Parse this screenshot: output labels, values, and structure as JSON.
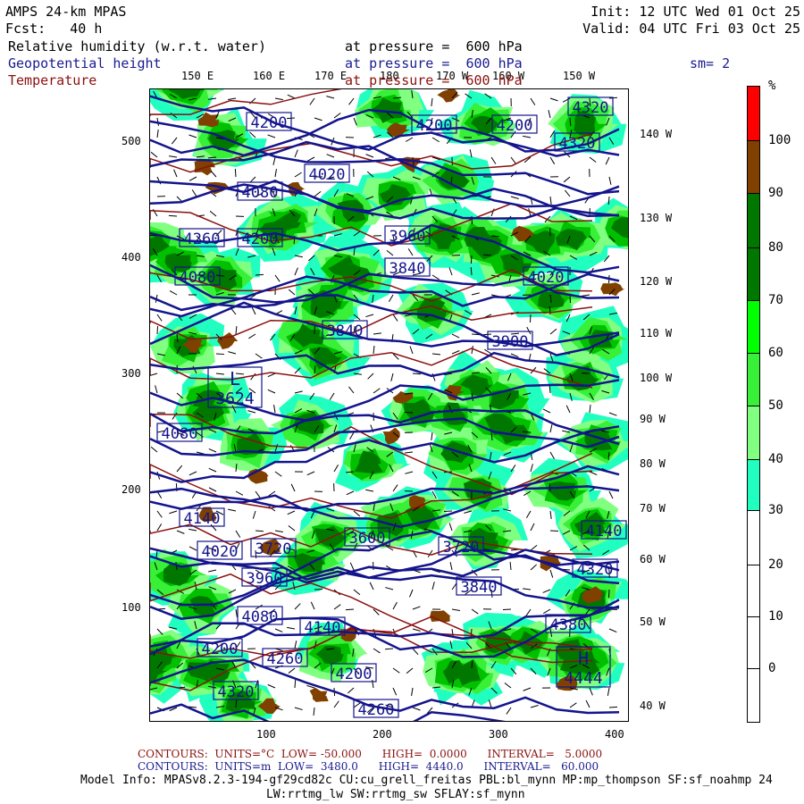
{
  "header": {
    "model": "AMPS 24-km MPAS",
    "forecast": "Fcst:   40 h",
    "init": "Init: 12 UTC Wed 01 Oct 25",
    "valid": "Valid: 04 UTC Fri 03 Oct 25",
    "fields": [
      {
        "name": "Relative humidity (w.r.t. water)",
        "level": "at pressure =  600 hPa"
      },
      {
        "name": "Geopotential height",
        "level": "at pressure =  600 hPa"
      },
      {
        "name": "Temperature",
        "level": "at pressure =  600 hPa"
      }
    ],
    "smoothing": "sm= 2"
  },
  "axes": {
    "top_lon": [
      "150 E",
      "160 E",
      "170 E",
      "180",
      "170 W",
      "160 W",
      "150 W"
    ],
    "right_lon": [
      "140 W",
      "130 W",
      "120 W",
      "110 W",
      "100 W",
      "90 W",
      "80 W",
      "70 W",
      "60 W",
      "50 W",
      "40 W"
    ],
    "left_y": [
      "500",
      "400",
      "300",
      "200",
      "100"
    ],
    "bottom_x": [
      "100",
      "200",
      "300",
      "400"
    ]
  },
  "colorbar": {
    "unit": "%",
    "labels": [
      "100",
      "90",
      "80",
      "70",
      "60",
      "50",
      "40",
      "30",
      "20",
      "10",
      "0"
    ],
    "colors": [
      "#ff0000",
      "#804000",
      "#007800",
      "#007800",
      "#00ff00",
      "#38f038",
      "#80ff80",
      "#20ffc0",
      "#ffffff",
      "#ffffff",
      "#ffffff",
      "#ffffff"
    ]
  },
  "map": {
    "height_color": "#14148c",
    "temp_color": "#8b1010",
    "contour_labels": [
      "4200",
      "4200",
      "4200",
      "4320",
      "4320",
      "4020",
      "4080",
      "4260",
      "4200",
      "4080",
      "4020",
      "3960",
      "3840",
      "3900",
      "3840",
      "4080",
      "4140",
      "4020",
      "3720",
      "3600",
      "3720",
      "3840",
      "3960",
      "4080",
      "4140",
      "4200",
      "4260",
      "4200",
      "4260",
      "4320",
      "4380",
      "4320",
      "4140"
    ],
    "low": {
      "symbol": "L",
      "value": "3624"
    },
    "high": {
      "symbol": "H",
      "value": "4444"
    }
  },
  "footer": {
    "temp_contours": "CONTOURS:  UNITS=°C  LOW= -50.000      HIGH=  0.0000      INTERVAL=   5.0000",
    "height_contours": "CONTOURS:  UNITS=m  LOW=  3480.0      HIGH=  4440.0      INTERVAL=   60.000",
    "model_info": "Model Info: MPASv8.2.3-194-gf29cd82c CU:cu_grell_freitas PBL:bl_mynn MP:mp_thompson SF:sf_noahmp 24",
    "model_info2": "LW:rrtmg_lw SW:rrtmg_sw SFLAY:sf_mynn"
  }
}
